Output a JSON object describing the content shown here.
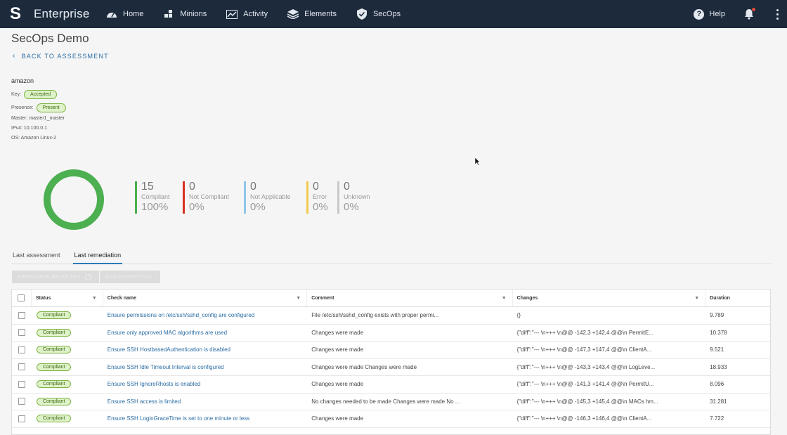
{
  "nav": {
    "brand": "Enterprise",
    "items": [
      {
        "label": "Home",
        "icon": "dashboard-icon"
      },
      {
        "label": "Minions",
        "icon": "minions-icon"
      },
      {
        "label": "Activity",
        "icon": "activity-chart-icon"
      },
      {
        "label": "Elements",
        "icon": "layers-icon"
      },
      {
        "label": "SecOps",
        "icon": "shield-check-icon"
      }
    ],
    "help": "Help"
  },
  "page": {
    "title": "SecOps Demo",
    "back": "BACK TO ASSESSMENT"
  },
  "minion": {
    "name": "amazon",
    "key_label": "Key:",
    "key_value": "Accepted",
    "presence_label": "Presence:",
    "presence_value": "Present",
    "master": "Master: master1_master",
    "ipv4": "IPv4: 10.100.0.1",
    "os": "OS: Amazon Linux-2"
  },
  "summary": {
    "donut_fraction_compliant": 1.0,
    "stats": [
      {
        "num": "15",
        "label": "Compliant",
        "pct": "100%",
        "color": "#4caf50"
      },
      {
        "num": "0",
        "label": "Not Compliant",
        "pct": "0%",
        "color": "#d93025"
      },
      {
        "num": "0",
        "label": "Not Applicable",
        "pct": "0%",
        "color": "#8fc5e8"
      },
      {
        "num": "0",
        "label": "Error",
        "pct": "0%",
        "color": "#f2c94c"
      },
      {
        "num": "0",
        "label": "Unknown",
        "pct": "0%",
        "color": "#c8c8c8"
      }
    ]
  },
  "tabs": [
    "Last assessment",
    "Last remediation"
  ],
  "actions": {
    "remediate": "REMEDIATE SELECTED",
    "exemption": "ADD EXEMPTION"
  },
  "table": {
    "headers": [
      "Status",
      "Check name",
      "Comment",
      "Changes",
      "Duration"
    ],
    "rows": [
      {
        "status": "Compliant",
        "check": "Ensure permissions on /etc/ssh/sshd_config are configured",
        "comment": "File /etc/ssh/sshd_config exists with proper permi...",
        "changes": "{}",
        "duration": "9.789"
      },
      {
        "status": "Compliant",
        "check": "Ensure only approved MAC algorithms are used",
        "comment": "Changes were made",
        "changes": "{\"diff\":\"--- \\n+++ \\n@@ -142,3 +142,4 @@\\n PermitE...",
        "duration": "10.378"
      },
      {
        "status": "Compliant",
        "check": "Ensure SSH HostbasedAuthentication is disabled",
        "comment": "Changes were made",
        "changes": "{\"diff\":\"--- \\n+++ \\n@@ -147,3 +147,4 @@\\n ClientA...",
        "duration": "9.521"
      },
      {
        "status": "Compliant",
        "check": "Ensure SSH Idle Timeout Interval is configured",
        "comment": "Changes were made Changes were made",
        "changes": "{\"diff\":\"--- \\n+++ \\n@@ -143,3 +143,4 @@\\n LogLeve...",
        "duration": "18.933"
      },
      {
        "status": "Compliant",
        "check": "Ensure SSH IgnoreRhosts is enabled",
        "comment": "Changes were made",
        "changes": "{\"diff\":\"--- \\n+++ \\n@@ -141,3 +141,4 @@\\n PermitU...",
        "duration": "8.096"
      },
      {
        "status": "Compliant",
        "check": "Ensure SSH access is limited",
        "comment": "No changes needed to be made Changes were made No ...",
        "changes": "{\"diff\":\"--- \\n+++ \\n@@ -145,3 +145,4 @@\\n MACs hm...",
        "duration": "31.281"
      },
      {
        "status": "Compliant",
        "check": "Ensure SSH LoginGraceTime is set to one minute or less",
        "comment": "Changes were made",
        "changes": "{\"diff\":\"--- \\n+++ \\n@@ -146,3 +146,4 @@\\n ClientA...",
        "duration": "7.722"
      }
    ]
  }
}
